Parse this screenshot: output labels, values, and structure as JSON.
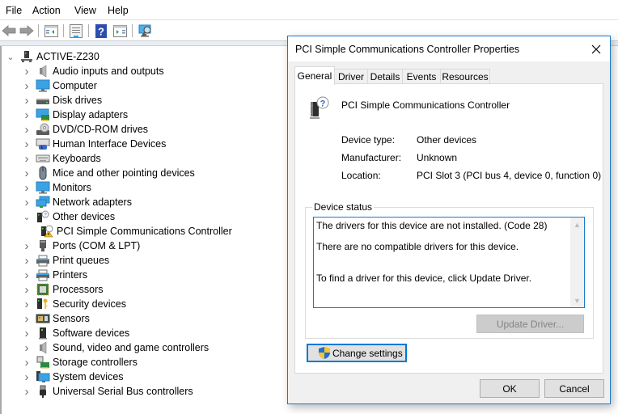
{
  "menubar": {
    "items": [
      "File",
      "Action",
      "View",
      "Help"
    ]
  },
  "toolbar": {
    "buttons": [
      "back-arrow",
      "forward-arrow",
      "show-hide-console-tree",
      "properties",
      "help",
      "show-hide-action-pane",
      "scan-for-hardware-changes"
    ]
  },
  "tree": {
    "root": {
      "label": "ACTIVE-Z230",
      "icon": "computer-tower-icon",
      "expanded": true
    },
    "categories": [
      {
        "label": "Audio inputs and outputs",
        "icon": "speaker-icon",
        "expanded": false
      },
      {
        "label": "Computer",
        "icon": "monitor-icon",
        "expanded": false
      },
      {
        "label": "Disk drives",
        "icon": "disk-drive-icon",
        "expanded": false
      },
      {
        "label": "Display adapters",
        "icon": "display-adapter-icon",
        "expanded": false
      },
      {
        "label": "DVD/CD-ROM drives",
        "icon": "dvd-drive-icon",
        "expanded": false
      },
      {
        "label": "Human Interface Devices",
        "icon": "hid-icon",
        "expanded": false
      },
      {
        "label": "Keyboards",
        "icon": "keyboard-icon",
        "expanded": false
      },
      {
        "label": "Mice and other pointing devices",
        "icon": "mouse-icon",
        "expanded": false
      },
      {
        "label": "Monitors",
        "icon": "monitor-icon",
        "expanded": false
      },
      {
        "label": "Network adapters",
        "icon": "network-adapter-icon",
        "expanded": false
      },
      {
        "label": "Other devices",
        "icon": "unknown-device-icon",
        "expanded": true,
        "children": [
          {
            "label": "PCI Simple Communications Controller",
            "icon": "warning-device-icon"
          }
        ]
      },
      {
        "label": "Ports (COM & LPT)",
        "icon": "port-icon",
        "expanded": false
      },
      {
        "label": "Print queues",
        "icon": "printer-icon",
        "expanded": false
      },
      {
        "label": "Printers",
        "icon": "printer-icon",
        "expanded": false
      },
      {
        "label": "Processors",
        "icon": "processor-icon",
        "expanded": false
      },
      {
        "label": "Security devices",
        "icon": "security-key-icon",
        "expanded": false
      },
      {
        "label": "Sensors",
        "icon": "sensor-icon",
        "expanded": false
      },
      {
        "label": "Software devices",
        "icon": "software-device-icon",
        "expanded": false
      },
      {
        "label": "Sound, video and game controllers",
        "icon": "speaker-icon",
        "expanded": false
      },
      {
        "label": "Storage controllers",
        "icon": "storage-controller-icon",
        "expanded": false
      },
      {
        "label": "System devices",
        "icon": "system-devices-icon",
        "expanded": false
      },
      {
        "label": "Universal Serial Bus controllers",
        "icon": "usb-icon",
        "expanded": false
      }
    ]
  },
  "dialog": {
    "title": "PCI Simple Communications Controller Properties",
    "tabs": [
      "General",
      "Driver",
      "Details",
      "Events",
      "Resources"
    ],
    "active_tab": "General",
    "device_name": "PCI Simple Communications Controller",
    "properties": [
      {
        "label": "Device type:",
        "value": "Other devices"
      },
      {
        "label": "Manufacturer:",
        "value": "Unknown"
      },
      {
        "label": "Location:",
        "value": "PCI Slot 3 (PCI bus 4, device 0, function 0)"
      }
    ],
    "device_status": {
      "legend": "Device status",
      "lines": [
        "The drivers for this device are not installed. (Code 28)",
        "There are no compatible drivers for this device.",
        "To find a driver for this device, click Update Driver."
      ]
    },
    "update_driver_label": "Update Driver...",
    "update_driver_enabled": false,
    "change_settings_label": "Change settings",
    "ok_label": "OK",
    "cancel_label": "Cancel"
  },
  "colors": {
    "accent": "#1979ca",
    "focus": "#0078d7",
    "dialog_bg": "#f0f0f0"
  }
}
